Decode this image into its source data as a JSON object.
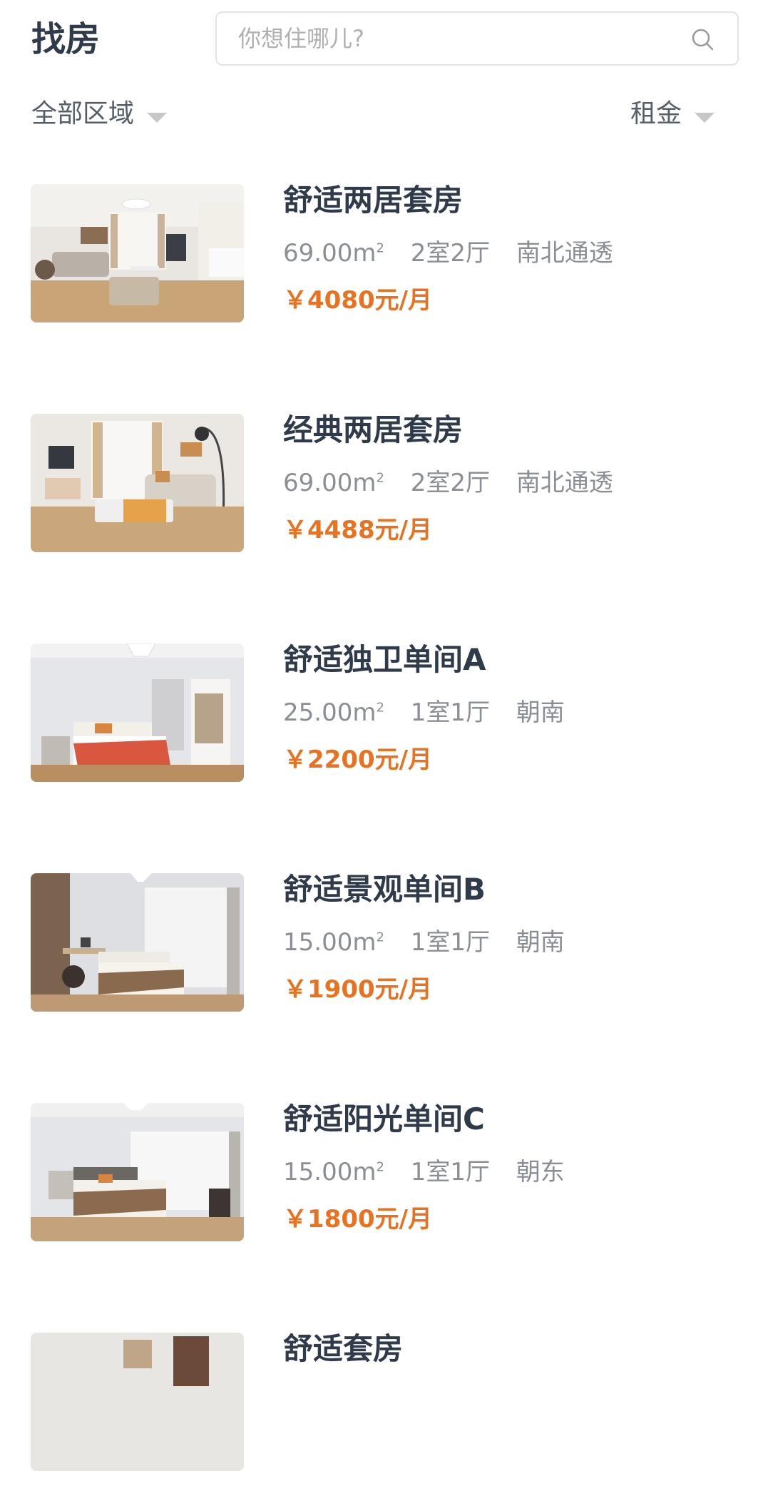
{
  "header": {
    "title": "找房",
    "search_placeholder": "你想住哪儿?"
  },
  "filters": {
    "area_label": "全部区域",
    "rent_label": "租金"
  },
  "listings": [
    {
      "title": "舒适两居套房",
      "area": "69.00m",
      "area_unit_sup": "2",
      "layout": "2室2厅",
      "orientation": "南北通透",
      "price": "￥4080元/月"
    },
    {
      "title": "经典两居套房",
      "area": "69.00m",
      "area_unit_sup": "2",
      "layout": "2室2厅",
      "orientation": "南北通透",
      "price": "￥4488元/月"
    },
    {
      "title": "舒适独卫单间A",
      "area": "25.00m",
      "area_unit_sup": "2",
      "layout": "1室1厅",
      "orientation": "朝南",
      "price": "￥2200元/月"
    },
    {
      "title": "舒适景观单间B",
      "area": "15.00m",
      "area_unit_sup": "2",
      "layout": "1室1厅",
      "orientation": "朝南",
      "price": "￥1900元/月"
    },
    {
      "title": "舒适阳光单间C",
      "area": "15.00m",
      "area_unit_sup": "2",
      "layout": "1室1厅",
      "orientation": "朝东",
      "price": "￥1800元/月"
    },
    {
      "title": "舒适套房"
    }
  ],
  "colors": {
    "title": "#2f3b4a",
    "detail": "#8a8f96",
    "price": "#e8721f",
    "caret": "#c7c7c7",
    "search_border": "#e3e3e3"
  }
}
